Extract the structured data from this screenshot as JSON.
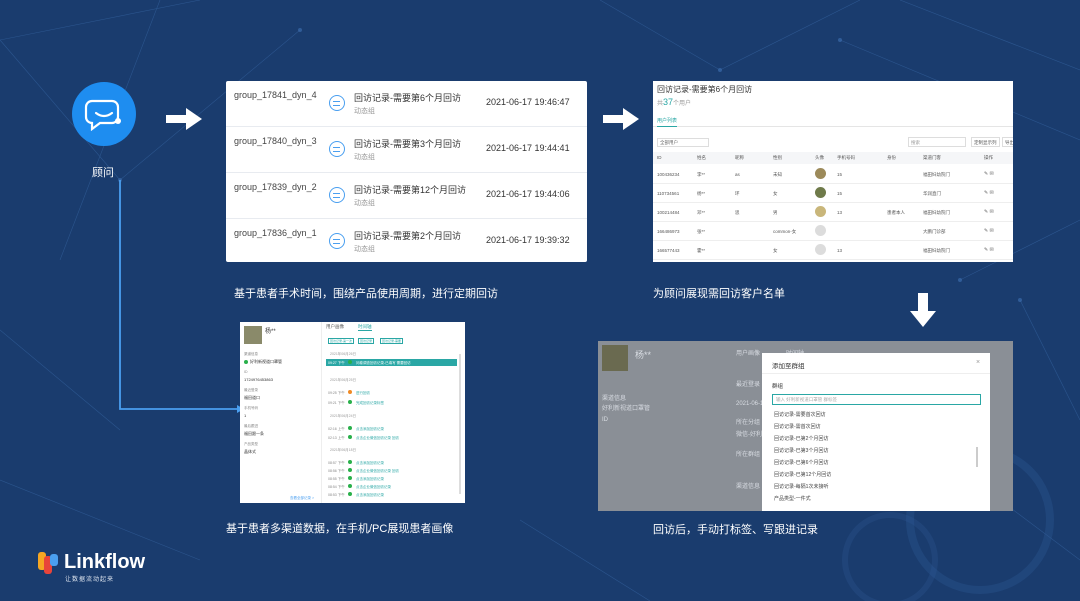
{
  "advisor": {
    "label": "顾问"
  },
  "captions": {
    "c1": "基于患者手术时间，围绕产品使用周期，进行定期回访",
    "c2": "为顾问展现需回访客户名单",
    "c3": "基于患者多渠道数据，在手机/PC展现患者画像",
    "c4": "回访后，手动打标签、写跟进记录"
  },
  "group_list": [
    {
      "name": "group_17841_dyn_4",
      "title": "回访记录-需要第6个月回访",
      "sub": "动态组",
      "time": "2021-06-17 19:46:47"
    },
    {
      "name": "group_17840_dyn_3",
      "title": "回访记录-需要第3个月回访",
      "sub": "动态组",
      "time": "2021-06-17 19:44:41"
    },
    {
      "name": "group_17839_dyn_2",
      "title": "回访记录-需要第12个月回访",
      "sub": "动态组",
      "time": "2021-06-17 19:44:06"
    },
    {
      "name": "group_17836_dyn_1",
      "title": "回访记录-需要第2个月回访",
      "sub": "动态组",
      "time": "2021-06-17 19:39:32"
    }
  ],
  "customer_list": {
    "title": "回访记录-需要第6个月回访",
    "count": "37",
    "count_suffix": "个用户",
    "tab": "用户列表",
    "select": "全部用户",
    "search_placeholder": "搜索",
    "btn_columns": "定制显示列",
    "btn_export": "导出",
    "headers": [
      "ID",
      "姓名",
      "昵称",
      "性别",
      "头像",
      "手机号码",
      "身份",
      "渠道门客",
      "操作"
    ],
    "rows": [
      {
        "id": "100436234",
        "name": "李**",
        "nick": "as",
        "gender": "未知",
        "phone": "15",
        "role": "",
        "channel": "福田妇幼院门"
      },
      {
        "id": "110734561",
        "name": "杨**",
        "nick": "环",
        "gender": "女",
        "phone": "15",
        "role": "",
        "channel": "华润直门"
      },
      {
        "id": "100214484",
        "name": "邓**",
        "nick": "思",
        "gender": "男",
        "phone": "13",
        "role": "患者本人",
        "channel": "福田妇幼院门"
      },
      {
        "id": "166486973",
        "name": "张**",
        "nick": "",
        "gender": "common-女",
        "phone": "",
        "role": "",
        "channel": "大鹏门诊部"
      },
      {
        "id": "166577443",
        "name": "霍**",
        "nick": "",
        "gender": "女",
        "phone": "13",
        "role": "",
        "channel": "福田妇幼院门"
      }
    ]
  },
  "profile": {
    "name": "杨**",
    "tab1": "用户画像",
    "tab2": "时间轴",
    "chips": [
      "回访记录-第一次",
      "回访记录",
      "回访记录-需要"
    ],
    "fields": [
      {
        "label": "渠道信息",
        "value": "好利新视道口罩管"
      },
      {
        "label": "ID",
        "value": "1724976453863"
      },
      {
        "label": "最近登录",
        "value": "福田道口"
      },
      {
        "label": "手机号码",
        "value": "1"
      },
      {
        "label": "最后跟进",
        "value": "福田跟一条"
      },
      {
        "label": "产品类型",
        "value": "晶体式"
      }
    ],
    "dates": [
      "2021年06月26日",
      "2021年06月25日",
      "2021年06月24日",
      "2021年06月18日"
    ],
    "events": [
      {
        "t": "09:27 下午",
        "x": "问卷调查回访记录-已填写 需要回访"
      },
      {
        "t": "09:25 下午",
        "x": "进行回访"
      },
      {
        "t": "09:21 下午",
        "x": "完成回访记录标签"
      },
      {
        "t": "02:16 上午",
        "x": "点击添加回访记录"
      },
      {
        "t": "02:13 上午",
        "x": "点击企业微信回访记录 回访"
      },
      {
        "t": "08:57 下午",
        "x": "点击添加回访记录"
      },
      {
        "t": "08:56 下午",
        "x": "点击企业微信回访记录 回访"
      },
      {
        "t": "08:55 下午",
        "x": "点击添加回访记录"
      },
      {
        "t": "08:54 下午",
        "x": "点击企业微信回访记录"
      },
      {
        "t": "08:53 下午",
        "x": "点击添加回访记录"
      }
    ],
    "footer": "查看全部记录 >"
  },
  "tag_modal": {
    "bg_name": "杨**",
    "bg_tab1": "用户画像",
    "bg_tab2": "时间轴",
    "bg_fields": [
      "渠道信息",
      "好利新视道口罩管",
      "ID",
      "最近登录",
      "2021-06-1",
      "所在分组",
      "微信-好利",
      "所在群组",
      "渠道信息"
    ],
    "title": "添加至群组",
    "field_label": "群组",
    "input_placeholder": "输入 好利新视道口罩管 群标签",
    "options": [
      "回访记录-需要首次回访",
      "回访记录-需首次回访",
      "回访记录-已第2个月回访",
      "回访记录-已第3个月回访",
      "回访记录-已第6个月回访",
      "回访记录-已第12个月回访",
      "回访记录-每隔1次未接听",
      "产品类型-一件式"
    ]
  },
  "logo": {
    "brand": "Linkflow",
    "slogan": "让数据流动起来"
  }
}
